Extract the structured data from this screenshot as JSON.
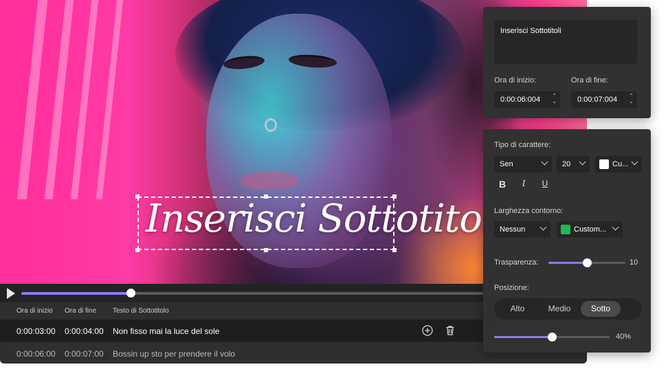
{
  "video": {
    "subtitle_overlay_text": "Inserisci Sottotitoli",
    "progress": 0.23
  },
  "table": {
    "headers": [
      "Ora di inizio",
      "Ora di fine",
      "Testo di Sottotitolo"
    ],
    "rows": [
      {
        "start": "0:00:03:00",
        "end": "0:00:04:00",
        "text": "Non fisso mai la luce del sole"
      },
      {
        "start": "0:00:06:00",
        "end": "0:00:07:00",
        "text": "Bossin up sto per prendere il volo"
      }
    ]
  },
  "panel_top": {
    "text_value": "Inserisci Sottotitoli",
    "start_label": "Ora di inizio:",
    "end_label": "Ora di fine:",
    "start_value": "0:00:06:004",
    "end_value": "0:00:07:004"
  },
  "panel_bottom": {
    "font_label": "Tipo di carattere:",
    "font_family": "Sen",
    "font_size": "20",
    "font_color_label": "Cu...",
    "font_color": "#ffffff",
    "format": {
      "bold": "B",
      "italic": "I",
      "underline": "U"
    },
    "outline_label": "Larghezza contorno:",
    "outline_width": "Nessun",
    "outline_color_label": "Custom...",
    "outline_color": "#1db954",
    "transparency_label": "Trasparenza:",
    "transparency_value": "10",
    "transparency_level": 0.5,
    "position_label": "Posizione:",
    "position_options": [
      "Alto",
      "Medio",
      "Sotto"
    ],
    "position_selected": "Sotto",
    "position_percent_text": "40%",
    "position_level": 0.5
  },
  "colors": {
    "accent": "#8a7cf3",
    "panel_bg": "#313131",
    "field_bg": "#262626"
  }
}
